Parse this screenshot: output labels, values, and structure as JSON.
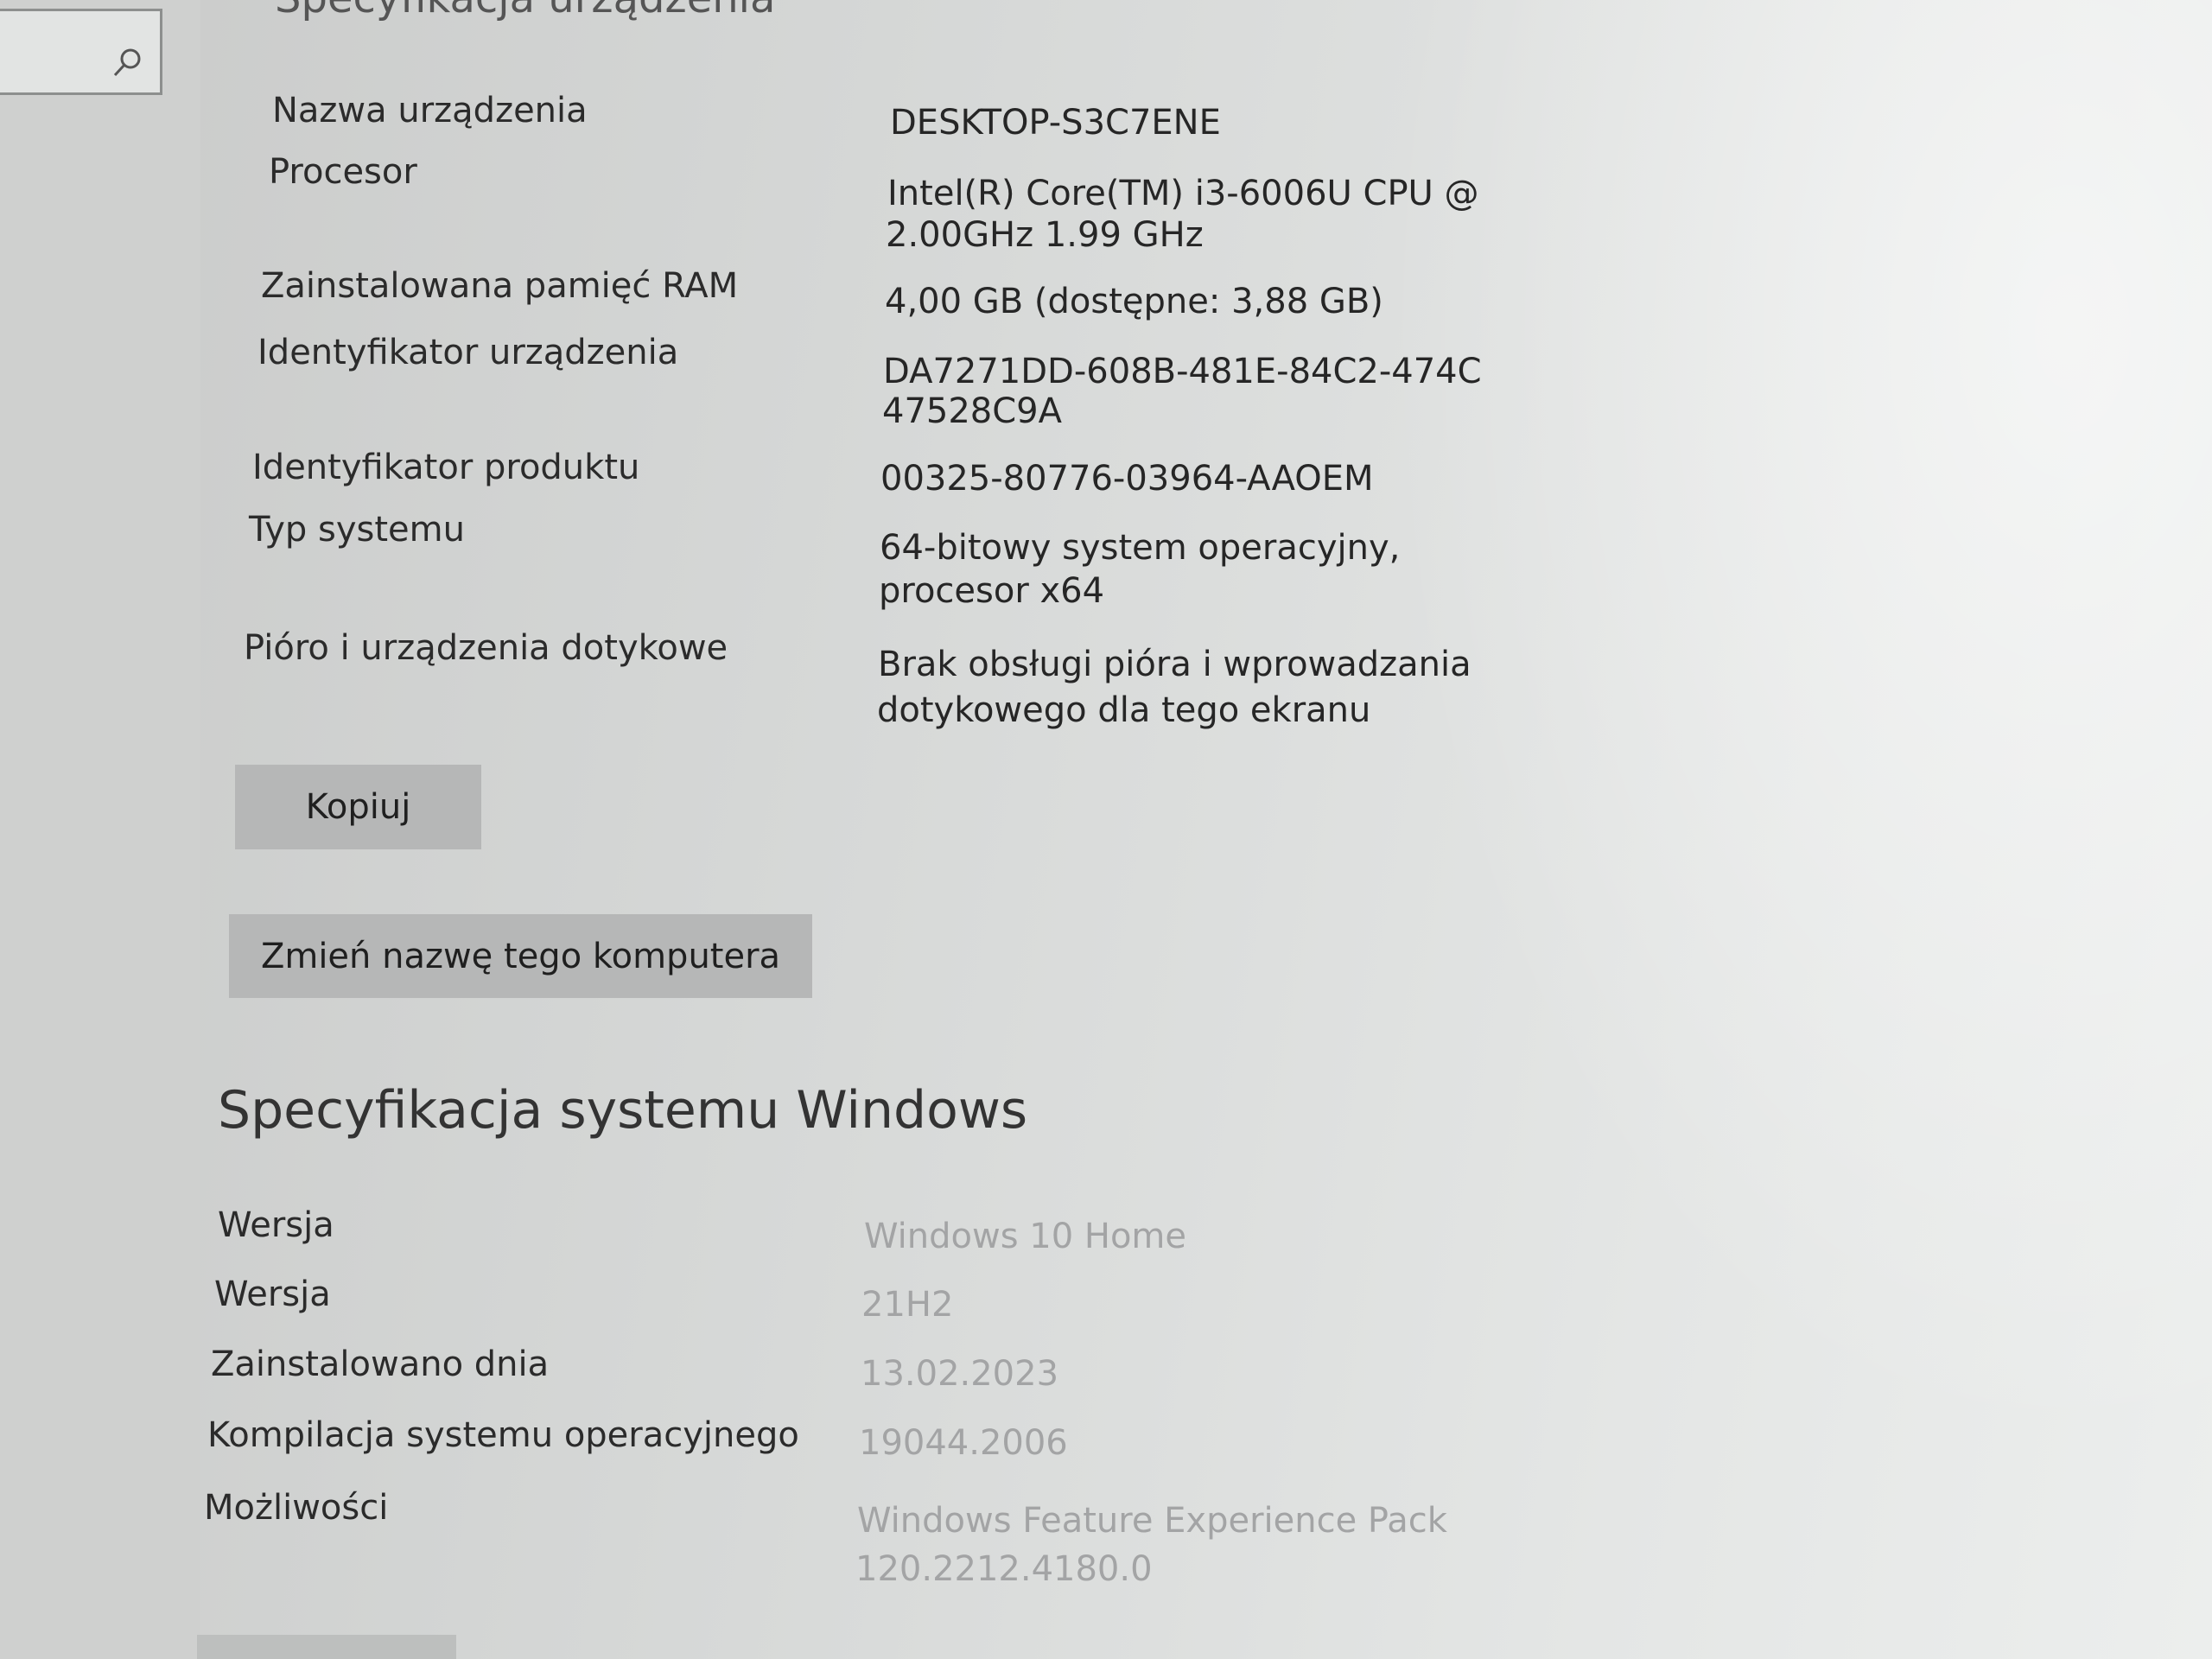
{
  "device_section": {
    "title": "Specyfikacja urządzenia",
    "rows": [
      {
        "label": "Nazwa urządzenia",
        "value": "DESKTOP-S3C7ENE"
      },
      {
        "label": "Procesor",
        "value_line1": "Intel(R) Core(TM) i3-6006U CPU @",
        "value_line2": "2.00GHz   1.99 GHz"
      },
      {
        "label": "Zainstalowana pamięć RAM",
        "value": "4,00 GB (dostępne: 3,88 GB)"
      },
      {
        "label": "Identyfikator urządzenia",
        "value_line1": "DA7271DD-608B-481E-84C2-474C",
        "value_line2": "47528C9A"
      },
      {
        "label": "Identyfikator produktu",
        "value": "00325-80776-03964-AAOEM"
      },
      {
        "label": "Typ systemu",
        "value_line1": "64-bitowy system operacyjny,",
        "value_line2": "procesor x64"
      },
      {
        "label": "Pióro i urządzenia dotykowe",
        "value_line1": "Brak obsługi pióra i wprowadzania",
        "value_line2": "dotykowego dla tego ekranu"
      }
    ],
    "copy_button": "Kopiuj",
    "rename_button": "Zmień nazwę tego komputera"
  },
  "windows_section": {
    "title": "Specyfikacja systemu Windows",
    "rows": [
      {
        "label": "Wersja",
        "value": "Windows 10 Home"
      },
      {
        "label": "Wersja",
        "value": "21H2"
      },
      {
        "label": "Zainstalowano dnia",
        "value": "13.02.2023"
      },
      {
        "label": "Kompilacja systemu operacyjnego",
        "value": "19044.2006"
      },
      {
        "label": "Możliwości",
        "value_line1": "Windows Feature Experience Pack",
        "value_line2": "120.2212.4180.0"
      }
    ]
  },
  "icons": {
    "search": "search-icon"
  }
}
